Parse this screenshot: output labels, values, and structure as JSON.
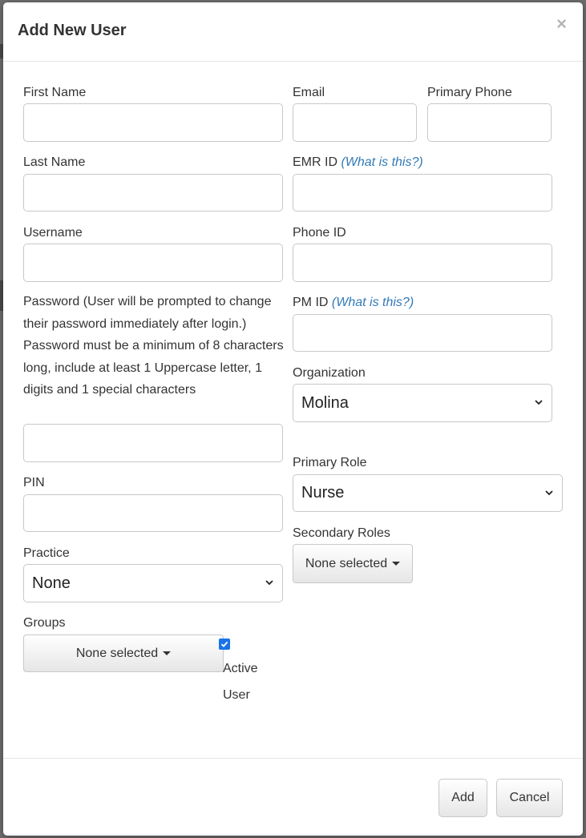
{
  "modal": {
    "title": "Add New User",
    "close_glyph": "×"
  },
  "form": {
    "first_name": {
      "label": "First Name",
      "value": ""
    },
    "last_name": {
      "label": "Last Name",
      "value": ""
    },
    "username": {
      "label": "Username",
      "value": ""
    },
    "password": {
      "label": "Password (User will be prompted to change their password immediately after login.) Password must be a minimum of 8 characters long, include at least 1 Uppercase letter, 1 digits and 1 special characters",
      "value": ""
    },
    "pin": {
      "label": "PIN",
      "value": ""
    },
    "practice": {
      "label": "Practice",
      "selected": "None"
    },
    "groups": {
      "label": "Groups",
      "button_label": "None selected"
    },
    "active_user": {
      "label": "Active User",
      "checked": true
    },
    "email": {
      "label": "Email",
      "value": ""
    },
    "primary_phone": {
      "label": "Primary Phone",
      "value": ""
    },
    "emr_id": {
      "label": "EMR ID",
      "help": "(What is this?)",
      "value": ""
    },
    "phone_id": {
      "label": "Phone ID",
      "value": ""
    },
    "pm_id": {
      "label": "PM ID",
      "help": "(What is this?)",
      "value": ""
    },
    "organization": {
      "label": "Organization",
      "selected": "Molina"
    },
    "primary_role": {
      "label": "Primary Role",
      "selected": "Nurse"
    },
    "secondary_roles": {
      "label": "Secondary Roles",
      "button_label": "None selected"
    }
  },
  "footer": {
    "add_label": "Add",
    "cancel_label": "Cancel"
  },
  "colors": {
    "link": "#337ab7",
    "checkbox": "#1a73e8"
  }
}
